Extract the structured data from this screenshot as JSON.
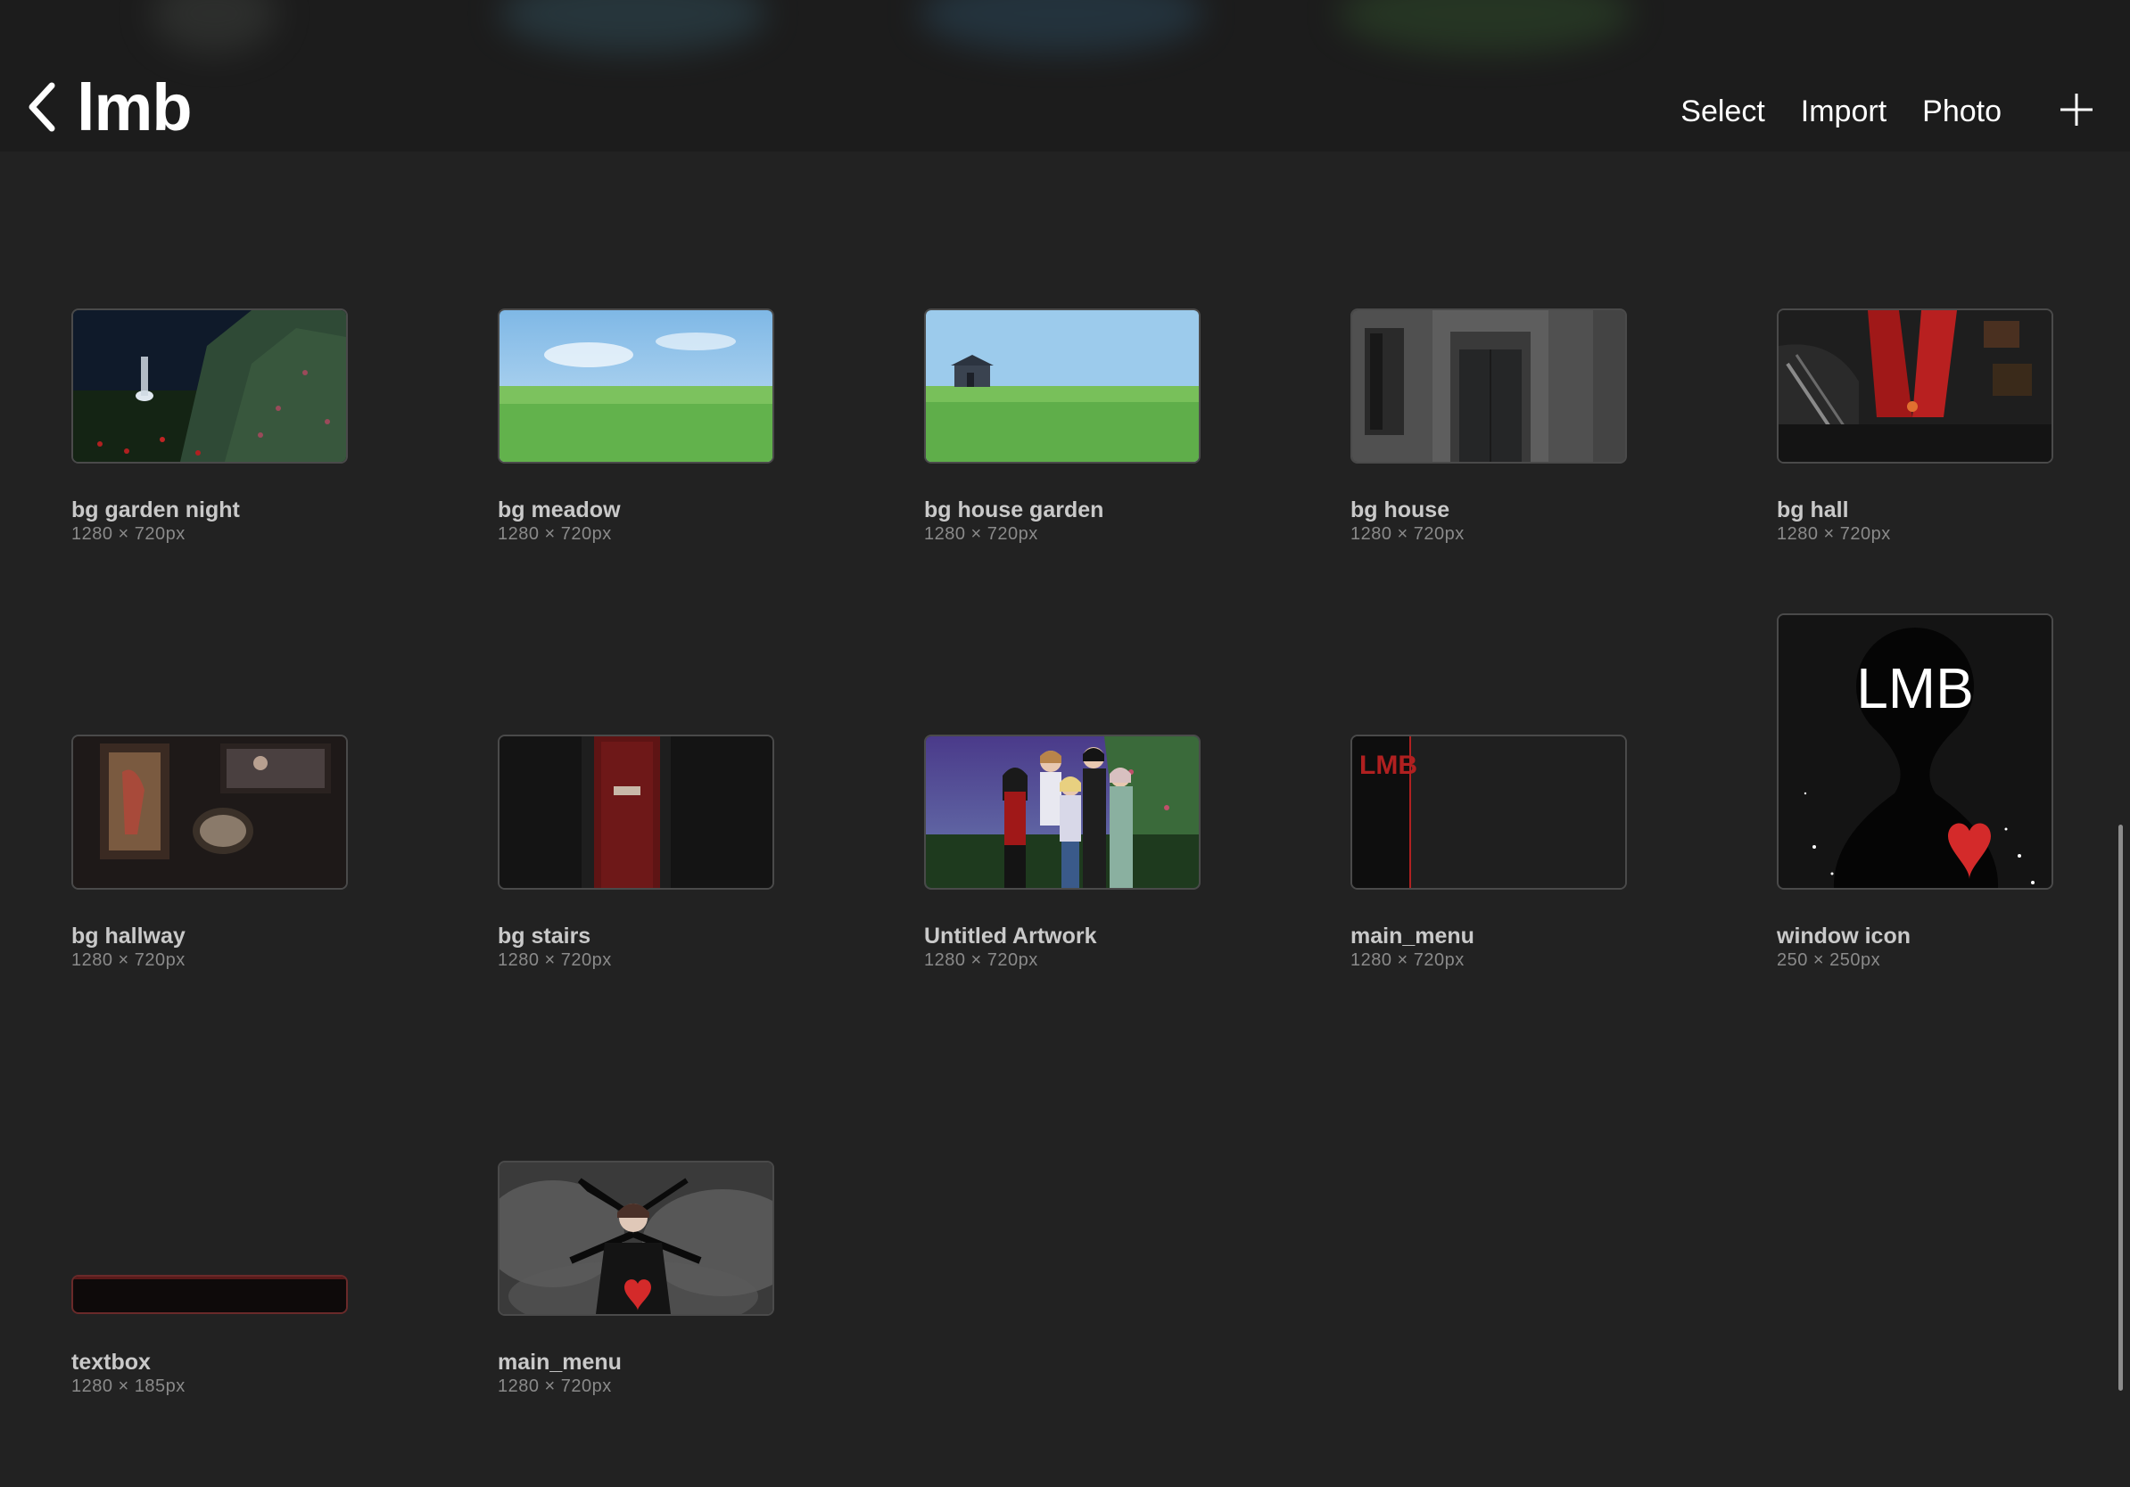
{
  "header": {
    "title": "lmb",
    "actions": {
      "select": "Select",
      "import": "Import",
      "photo": "Photo"
    }
  },
  "artworks": [
    {
      "name": "bg garden night",
      "dims": "1280 × 720px"
    },
    {
      "name": "bg meadow",
      "dims": "1280 × 720px"
    },
    {
      "name": "bg house garden",
      "dims": "1280 × 720px"
    },
    {
      "name": "bg house",
      "dims": "1280 × 720px"
    },
    {
      "name": "bg hall",
      "dims": "1280 × 720px"
    },
    {
      "name": "bg hallway",
      "dims": "1280 × 720px"
    },
    {
      "name": "bg stairs",
      "dims": "1280 × 720px"
    },
    {
      "name": "Untitled Artwork",
      "dims": "1280 × 720px"
    },
    {
      "name": "main_menu",
      "dims": "1280 × 720px"
    },
    {
      "name": "window icon",
      "dims": "250 × 250px"
    },
    {
      "name": "textbox",
      "dims": "1280 × 185px"
    },
    {
      "name": "main_menu",
      "dims": "1280 × 720px"
    }
  ],
  "thumb_text": {
    "main_menu_logo": "LMB",
    "window_icon_logo": "LMB"
  },
  "colors": {
    "background": "#222222",
    "accent_red": "#c0221e",
    "sky_blue": "#a9d3ef",
    "grass_green": "#5fae4a"
  }
}
